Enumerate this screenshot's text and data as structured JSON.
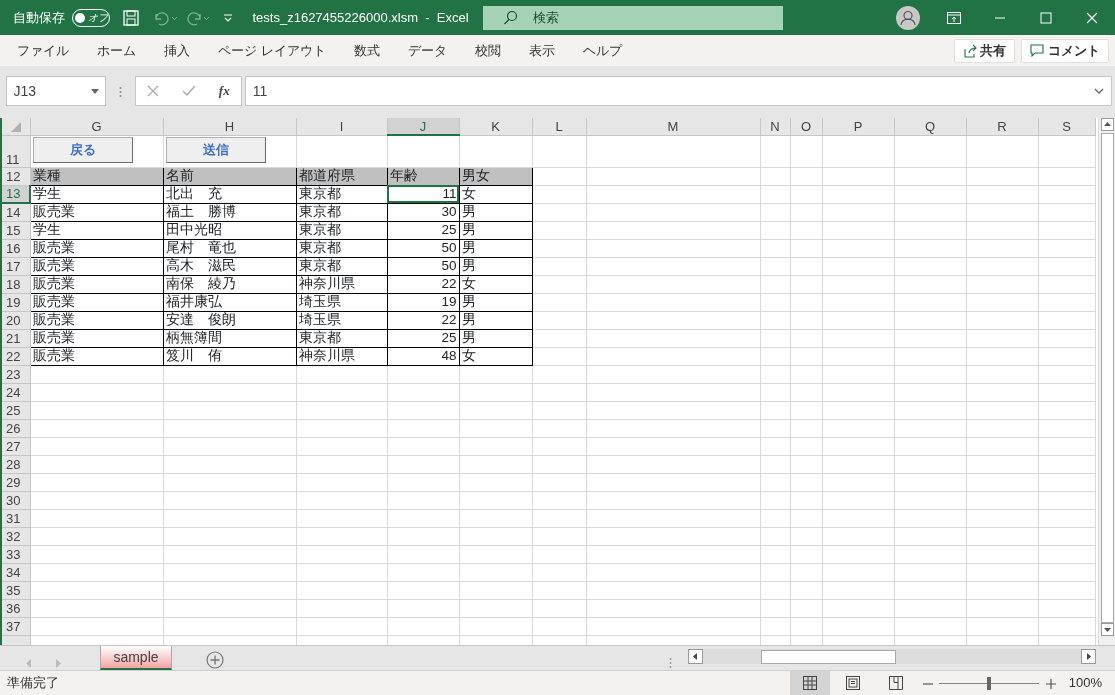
{
  "title_bar": {
    "autosave_label": "自動保存",
    "autosave": {
      "label": "オフ",
      "on": false
    },
    "file_title": "tests_z1627455226000.xlsm  -  Excel",
    "search_placeholder": "検索"
  },
  "ribbon_tabs": [
    {
      "label": "ファイル"
    },
    {
      "label": "ホーム"
    },
    {
      "label": "挿入"
    },
    {
      "label": "ページ レイアウト"
    },
    {
      "label": "数式"
    },
    {
      "label": "データ"
    },
    {
      "label": "校閲"
    },
    {
      "label": "表示"
    },
    {
      "label": "ヘルプ"
    }
  ],
  "ribbon_buttons": [
    {
      "kind": "share",
      "label": "共有"
    },
    {
      "kind": "comment",
      "label": "コメント"
    }
  ],
  "formula_bar": {
    "name_box": "J13",
    "function_label": "fx",
    "value": "11"
  },
  "columns": [
    {
      "letter": "G",
      "selected": false
    },
    {
      "letter": "H",
      "selected": false
    },
    {
      "letter": "I",
      "selected": false
    },
    {
      "letter": "J",
      "selected": true
    },
    {
      "letter": "K",
      "selected": false
    },
    {
      "letter": "L",
      "selected": false
    },
    {
      "letter": "M",
      "selected": false
    },
    {
      "letter": "N",
      "selected": false
    },
    {
      "letter": "O",
      "selected": false
    },
    {
      "letter": "P",
      "selected": false
    },
    {
      "letter": "Q",
      "selected": false
    },
    {
      "letter": "R",
      "selected": false
    },
    {
      "letter": "S",
      "selected": false
    }
  ],
  "sheet_buttons": [
    {
      "label": "戻る"
    },
    {
      "label": "送信"
    }
  ],
  "rows": [
    {
      "number": "11",
      "selected": false,
      "kind": "buttons"
    },
    {
      "number": "12",
      "selected": false,
      "kind": "header",
      "cells": [
        "業種",
        "名前",
        "都道府県",
        "年齢",
        "男女"
      ]
    },
    {
      "number": "13",
      "selected": true,
      "kind": "data",
      "cells": [
        "学生",
        "北出　充",
        "東京都",
        "11",
        "女"
      ]
    },
    {
      "number": "14",
      "selected": false,
      "kind": "data",
      "cells": [
        "販売業",
        "福土　勝博",
        "東京都",
        "30",
        "男"
      ]
    },
    {
      "number": "15",
      "selected": false,
      "kind": "data",
      "cells": [
        "学生",
        "田中光昭",
        "東京都",
        "25",
        "男"
      ]
    },
    {
      "number": "16",
      "selected": false,
      "kind": "data",
      "cells": [
        "販売業",
        "尾村　竜也",
        "東京都",
        "50",
        "男"
      ]
    },
    {
      "number": "17",
      "selected": false,
      "kind": "data",
      "cells": [
        "販売業",
        "高木　滋民",
        "東京都",
        "50",
        "男"
      ]
    },
    {
      "number": "18",
      "selected": false,
      "kind": "data",
      "cells": [
        "販売業",
        "南保　綾乃",
        "神奈川県",
        "22",
        "女"
      ]
    },
    {
      "number": "19",
      "selected": false,
      "kind": "data",
      "cells": [
        "販売業",
        "福井康弘",
        "埼玉県",
        "19",
        "男"
      ]
    },
    {
      "number": "20",
      "selected": false,
      "kind": "data",
      "cells": [
        "販売業",
        "安達　俊朗",
        "埼玉県",
        "22",
        "男"
      ]
    },
    {
      "number": "21",
      "selected": false,
      "kind": "data",
      "cells": [
        "販売業",
        "柄無簿間",
        "東京都",
        "25",
        "男"
      ]
    },
    {
      "number": "22",
      "selected": false,
      "kind": "data",
      "cells": [
        "販売業",
        "笈川　侑",
        "神奈川県",
        "48",
        "女"
      ]
    },
    {
      "number": "23",
      "selected": false,
      "kind": "empty"
    },
    {
      "number": "24",
      "selected": false,
      "kind": "empty"
    },
    {
      "number": "25",
      "selected": false,
      "kind": "empty"
    },
    {
      "number": "26",
      "selected": false,
      "kind": "empty"
    },
    {
      "number": "27",
      "selected": false,
      "kind": "empty"
    },
    {
      "number": "28",
      "selected": false,
      "kind": "empty"
    },
    {
      "number": "29",
      "selected": false,
      "kind": "empty"
    },
    {
      "number": "30",
      "selected": false,
      "kind": "empty"
    },
    {
      "number": "31",
      "selected": false,
      "kind": "empty"
    },
    {
      "number": "32",
      "selected": false,
      "kind": "empty"
    },
    {
      "number": "33",
      "selected": false,
      "kind": "empty"
    },
    {
      "number": "34",
      "selected": false,
      "kind": "empty"
    },
    {
      "number": "35",
      "selected": false,
      "kind": "empty"
    },
    {
      "number": "36",
      "selected": false,
      "kind": "empty"
    },
    {
      "number": "37",
      "selected": false,
      "kind": "empty"
    }
  ],
  "sheet_tabs": [
    {
      "label": "sample",
      "selected": true
    }
  ],
  "status_bar": {
    "text": "準備完了",
    "zoom": {
      "level": 0.5
    },
    "zoom_label": "100%"
  }
}
